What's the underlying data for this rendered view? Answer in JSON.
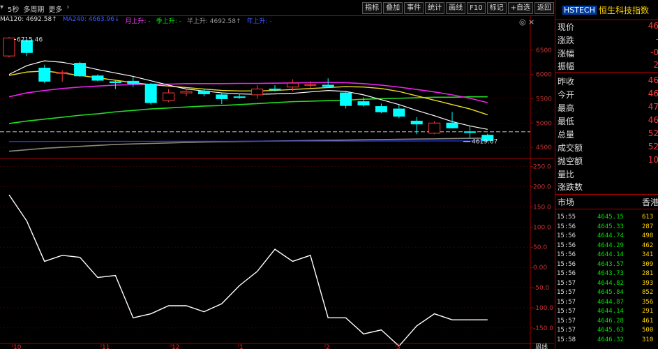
{
  "toolbar": {
    "period_label": "5秒",
    "multi_period_label": "多周期",
    "more_label": "更多",
    "buttons": [
      "指标",
      "叠加",
      "事件",
      "统计",
      "画线",
      "F10",
      "标记",
      "+自选",
      "返回"
    ]
  },
  "ma_legend": [
    {
      "text": "MA120: 4692.58↑",
      "color": "#dddddd"
    },
    {
      "text": "MA240: 4663.96↓",
      "color": "#3d5bff"
    },
    {
      "text": "月上升: -",
      "color": "#ff44ff"
    },
    {
      "text": "季上升: -",
      "color": "#00dd00"
    },
    {
      "text": "半上升: 4692.58↑",
      "color": "#999999"
    },
    {
      "text": "年上升: -",
      "color": "#3d5bff"
    }
  ],
  "main_chart": {
    "high_marker": "6715.46",
    "low_marker": "4619.67",
    "y_ticks": [
      "6500",
      "6000",
      "5500",
      "5000",
      "4500"
    ],
    "y_range": [
      4300,
      7000
    ],
    "candles": [
      {
        "o": 6380,
        "c": 6750,
        "h": 6770,
        "l": 6350
      },
      {
        "o": 6700,
        "c": 6450,
        "h": 6730,
        "l": 6380
      },
      {
        "o": 6130,
        "c": 5860,
        "h": 6200,
        "l": 5820
      },
      {
        "o": 6020,
        "c": 6040,
        "h": 6090,
        "l": 5850
      },
      {
        "o": 6230,
        "c": 5970,
        "h": 6260,
        "l": 5950
      },
      {
        "o": 5970,
        "c": 5880,
        "h": 6000,
        "l": 5860
      },
      {
        "o": 5850,
        "c": 5830,
        "h": 5890,
        "l": 5700
      },
      {
        "o": 5860,
        "c": 5810,
        "h": 5950,
        "l": 5740
      },
      {
        "o": 5800,
        "c": 5420,
        "h": 5820,
        "l": 5380
      },
      {
        "o": 5460,
        "c": 5620,
        "h": 5700,
        "l": 5430
      },
      {
        "o": 5620,
        "c": 5650,
        "h": 5700,
        "l": 5550
      },
      {
        "o": 5660,
        "c": 5600,
        "h": 5700,
        "l": 5550
      },
      {
        "o": 5580,
        "c": 5500,
        "h": 5620,
        "l": 5390
      },
      {
        "o": 5540,
        "c": 5530,
        "h": 5600,
        "l": 5500
      },
      {
        "o": 5580,
        "c": 5700,
        "h": 5780,
        "l": 5500
      },
      {
        "o": 5700,
        "c": 5680,
        "h": 5780,
        "l": 5650
      },
      {
        "o": 5740,
        "c": 5820,
        "h": 5900,
        "l": 5650
      },
      {
        "o": 5780,
        "c": 5790,
        "h": 5860,
        "l": 5720
      },
      {
        "o": 5780,
        "c": 5750,
        "h": 5920,
        "l": 5720
      },
      {
        "o": 5620,
        "c": 5360,
        "h": 5650,
        "l": 5300
      },
      {
        "o": 5440,
        "c": 5370,
        "h": 5530,
        "l": 5340
      },
      {
        "o": 5340,
        "c": 5230,
        "h": 5400,
        "l": 5200
      },
      {
        "o": 5290,
        "c": 5140,
        "h": 5370,
        "l": 5100
      },
      {
        "o": 5040,
        "c": 4980,
        "h": 5120,
        "l": 4770
      },
      {
        "o": 4790,
        "c": 5000,
        "h": 5040,
        "l": 4770
      },
      {
        "o": 5000,
        "c": 4900,
        "h": 5230,
        "l": 4890
      },
      {
        "o": 4820,
        "c": 4810,
        "h": 4930,
        "l": 4700
      },
      {
        "o": 4750,
        "c": 4640,
        "h": 4780,
        "l": 4620
      }
    ],
    "ma_white": [
      6000,
      6180,
      6280,
      6250,
      6180,
      6100,
      6030,
      5960,
      5870,
      5780,
      5700,
      5660,
      5620,
      5600,
      5590,
      5600,
      5610,
      5640,
      5670,
      5650,
      5580,
      5480,
      5380,
      5260,
      5150,
      5030,
      4940,
      4870
    ],
    "ma_yellow": [
      5980,
      6050,
      6070,
      6030,
      5980,
      5930,
      5880,
      5830,
      5790,
      5760,
      5730,
      5700,
      5670,
      5660,
      5660,
      5670,
      5690,
      5710,
      5730,
      5750,
      5740,
      5710,
      5650,
      5560,
      5470,
      5380,
      5290,
      5170
    ],
    "ma_magenta": [
      5540,
      5620,
      5670,
      5710,
      5740,
      5760,
      5780,
      5790,
      5800,
      5800,
      5810,
      5810,
      5810,
      5815,
      5815,
      5820,
      5825,
      5830,
      5835,
      5830,
      5810,
      5780,
      5740,
      5690,
      5640,
      5580,
      5510,
      5420
    ],
    "ma_green": [
      4990,
      5040,
      5080,
      5120,
      5160,
      5190,
      5230,
      5260,
      5290,
      5310,
      5330,
      5350,
      5360,
      5380,
      5400,
      5420,
      5440,
      5450,
      5460,
      5470,
      5490,
      5500,
      5510,
      5520,
      5530,
      5530,
      5540,
      5540
    ],
    "ma_gray": [
      4420,
      4450,
      4480,
      4500,
      4520,
      4540,
      4560,
      4570,
      4580,
      4590,
      4600,
      4610,
      4615,
      4620,
      4625,
      4630,
      4635,
      4640,
      4645,
      4650,
      4655,
      4660,
      4665,
      4670,
      4675,
      4680,
      4685,
      4690
    ],
    "ma_blue": [
      4620,
      4620,
      4621,
      4622,
      4622,
      4623,
      4623,
      4624,
      4624,
      4625,
      4625,
      4626,
      4626,
      4626,
      4627,
      4627,
      4628,
      4628,
      4628,
      4629,
      4629,
      4630,
      4630,
      4630,
      4631,
      4631,
      4631,
      4632
    ],
    "current_price_line": 4820
  },
  "osc_chart": {
    "y_ticks": [
      "250.0",
      "200.0",
      "150.0",
      "100.0",
      "50.0",
      "0.00",
      "-50.0",
      "-100.0",
      "-150.0"
    ],
    "y_range": [
      -185,
      265
    ],
    "values": [
      180,
      115,
      15,
      30,
      25,
      -25,
      -20,
      -125,
      -115,
      -95,
      -95,
      -110,
      -90,
      -45,
      -10,
      45,
      15,
      30,
      -125,
      -125,
      -165,
      -155,
      -195,
      -145,
      -115,
      -130,
      -130,
      -130
    ]
  },
  "x_axis_labels": [
    "10",
    "11",
    "12",
    "1",
    "2",
    "3"
  ],
  "x_axis_tail_label": "周线",
  "right_panel": {
    "code": "HSTECH",
    "name": "恒生科技指数",
    "quote_rows": [
      {
        "label": "现价",
        "value": "46"
      },
      {
        "label": "涨跌",
        "value": "-"
      },
      {
        "label": "涨幅",
        "value": "-0"
      },
      {
        "label": "振幅",
        "value": "2"
      },
      {
        "label": "昨收",
        "value": "46"
      },
      {
        "label": "今开",
        "value": "46"
      },
      {
        "label": "最高",
        "value": "47"
      },
      {
        "label": "最低",
        "value": "46"
      },
      {
        "label": "总量",
        "value": "52"
      },
      {
        "label": "成交额",
        "value": "52"
      },
      {
        "label": "抛空额",
        "value": "10"
      },
      {
        "label": "量比",
        "value": ""
      },
      {
        "label": "涨跌数",
        "value": ""
      }
    ],
    "market_label": "市场",
    "market_value": "香港",
    "ticks": [
      {
        "time": "15:55",
        "price": "4645.15",
        "vol": "613"
      },
      {
        "time": "15:56",
        "price": "4645.33",
        "vol": "287"
      },
      {
        "time": "15:56",
        "price": "4644.74",
        "vol": "498"
      },
      {
        "time": "15:56",
        "price": "4644.29",
        "vol": "462"
      },
      {
        "time": "15:56",
        "price": "4644.14",
        "vol": "341"
      },
      {
        "time": "15:56",
        "price": "4643.57",
        "vol": "309"
      },
      {
        "time": "15:56",
        "price": "4643.73",
        "vol": "281"
      },
      {
        "time": "15:57",
        "price": "4644.82",
        "vol": "393"
      },
      {
        "time": "15:57",
        "price": "4645.84",
        "vol": "852"
      },
      {
        "time": "15:57",
        "price": "4644.87",
        "vol": "356"
      },
      {
        "time": "15:57",
        "price": "4644.14",
        "vol": "291"
      },
      {
        "time": "15:57",
        "price": "4646.28",
        "vol": "461"
      },
      {
        "time": "15:57",
        "price": "4645.63",
        "vol": "500"
      },
      {
        "time": "15:58",
        "price": "4646.32",
        "vol": "310"
      }
    ]
  },
  "colors": {
    "up": "#ff3b3b",
    "down": "#00ffff",
    "axis": "#a00000",
    "grid": "#5a0000"
  }
}
